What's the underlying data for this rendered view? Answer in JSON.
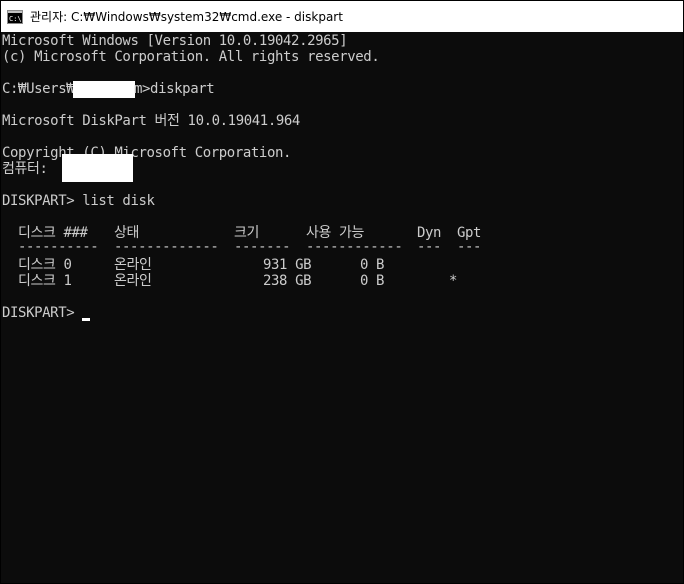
{
  "window": {
    "title": "관리자: C:₩Windows₩system32₩cmd.exe - diskpart",
    "icon": "cmd-icon"
  },
  "console": {
    "line_version": "Microsoft Windows [Version 10.0.19042.2965]",
    "line_copyright": "(c) Microsoft Corporation. All rights reserved.",
    "prompt_prefix": "C:₩Users₩",
    "prompt_suffix": "m>diskpart",
    "diskpart_version": "Microsoft DiskPart 버전 10.0.19041.964",
    "diskpart_copyright": "Copyright (C) Microsoft Corporation.",
    "computer_label": "컴퓨터:",
    "list_command": "DISKPART> list disk",
    "table": {
      "headers": [
        "디스크 ###",
        "상태",
        "크기",
        "사용 가능",
        "Dyn",
        "Gpt"
      ],
      "separators": [
        "----------",
        "-------------",
        "-------",
        "------------",
        "---",
        "---"
      ],
      "rows": [
        [
          "디스크 0",
          "온라인",
          "931 GB",
          "0 B",
          "",
          ""
        ],
        [
          "디스크 1",
          "온라인",
          "238 GB",
          "0 B",
          "",
          "*"
        ]
      ]
    },
    "final_prompt": "DISKPART> "
  }
}
